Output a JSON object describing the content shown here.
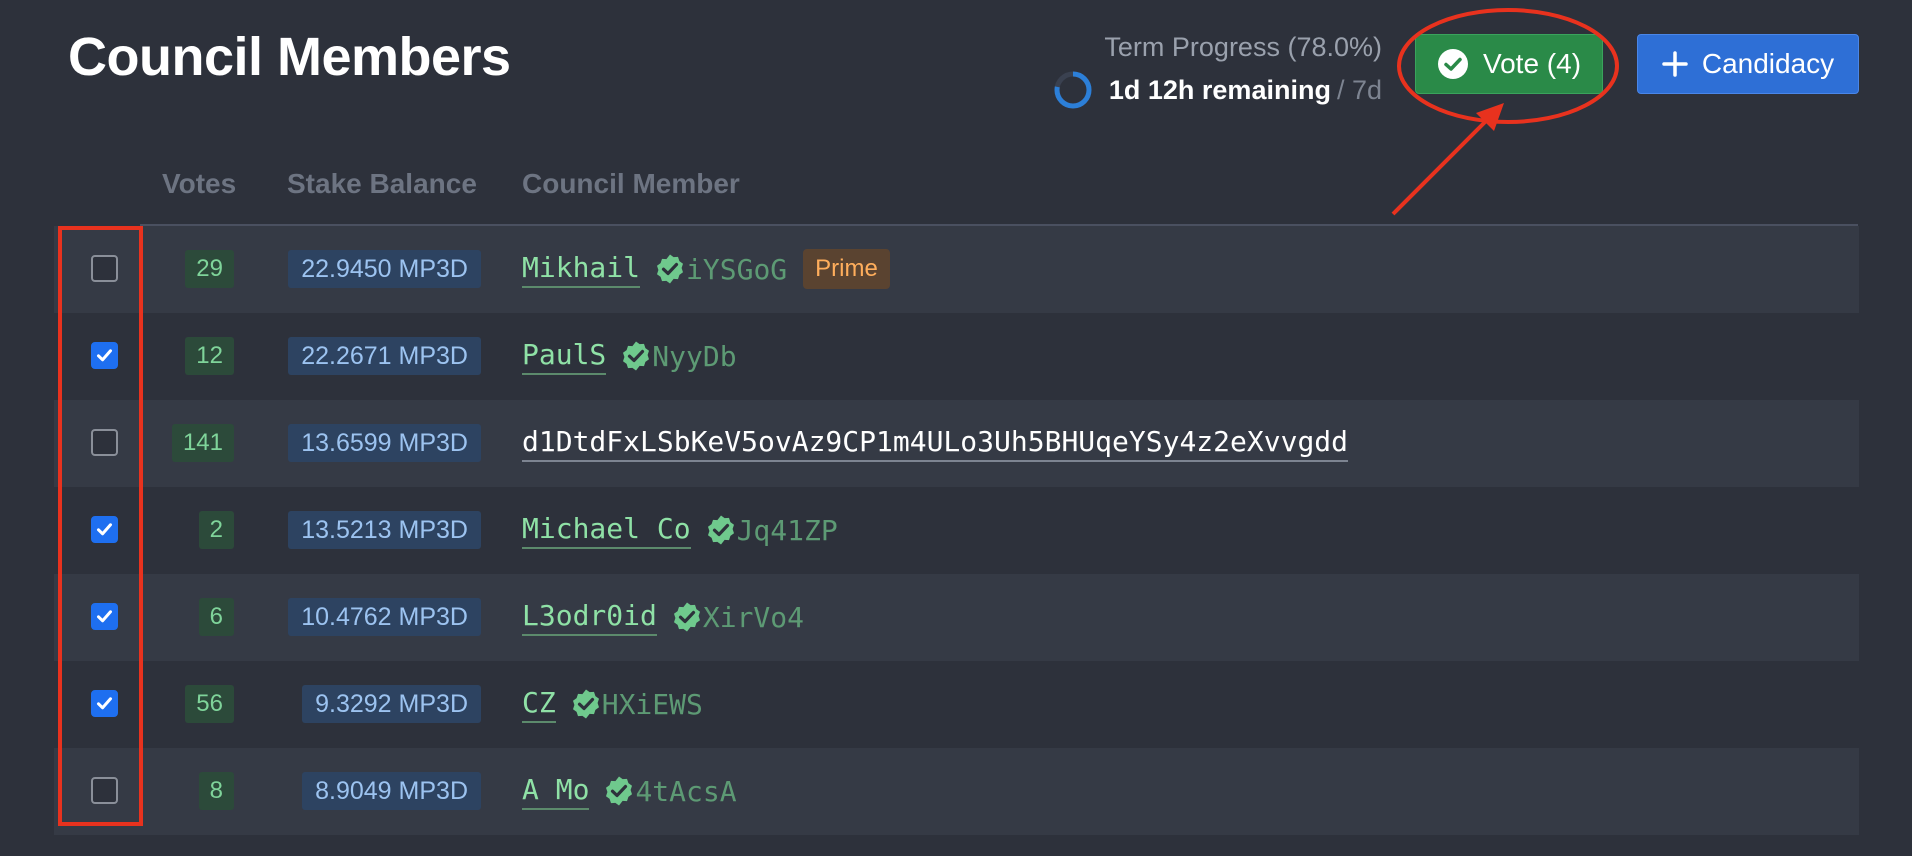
{
  "header": {
    "title": "Council Members",
    "term_progress_label": "Term Progress (78.0%)",
    "term_progress": 0.78,
    "remaining": "1d 12h remaining",
    "total": "/ 7d"
  },
  "actions": {
    "vote_label": "Vote (4)",
    "candidacy_label": "Candidacy"
  },
  "colors": {
    "vote_button": "#2a8a48",
    "candidacy_button": "#2e6fd6",
    "annotation": "#e8321e",
    "checkbox_checked": "#1e6ff0"
  },
  "table": {
    "columns": [
      "Votes",
      "Stake Balance",
      "Council Member"
    ],
    "rows": [
      {
        "checked": false,
        "votes": "29",
        "stake": "22.9450 MP3D",
        "name": "Mikhail",
        "verified": true,
        "address": "iYSGoG",
        "badge": "Prime"
      },
      {
        "checked": true,
        "votes": "12",
        "stake": "22.2671 MP3D",
        "name": "PaulS",
        "verified": true,
        "address": "NyyDb",
        "badge": ""
      },
      {
        "checked": false,
        "votes": "141",
        "stake": "13.6599 MP3D",
        "name": "d1DtdFxLSbKeV5ovAz9CP1m4ULo3Uh5BHUqeYSy4z2eXvvgdd",
        "verified": false,
        "address": "",
        "badge": ""
      },
      {
        "checked": true,
        "votes": "2",
        "stake": "13.5213 MP3D",
        "name": "Michael Co",
        "verified": true,
        "address": "Jq41ZP",
        "badge": ""
      },
      {
        "checked": true,
        "votes": "6",
        "stake": "10.4762 MP3D",
        "name": "L3odr0id",
        "verified": true,
        "address": "XirVo4",
        "badge": ""
      },
      {
        "checked": true,
        "votes": "56",
        "stake": "9.3292 MP3D",
        "name": "CZ",
        "verified": true,
        "address": "HXiEWS",
        "badge": ""
      },
      {
        "checked": false,
        "votes": "8",
        "stake": "8.9049 MP3D",
        "name": "A Mo",
        "verified": true,
        "address": "4tAcsA",
        "badge": ""
      }
    ]
  }
}
